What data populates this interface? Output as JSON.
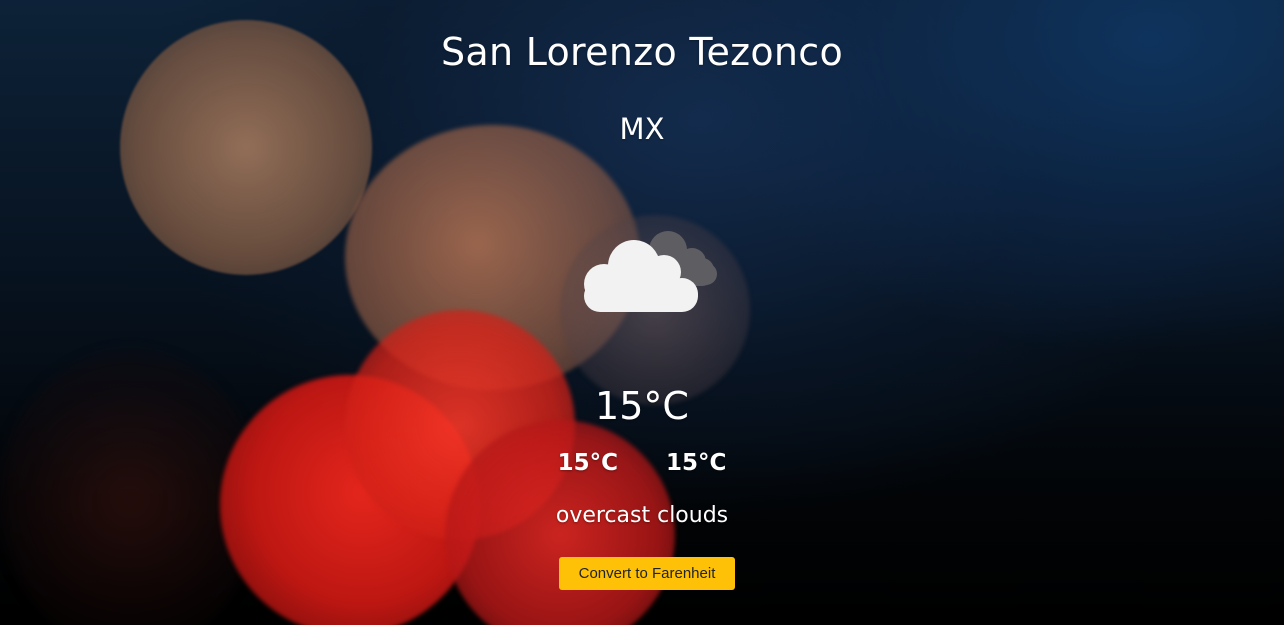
{
  "location": {
    "city": "San Lorenzo Tezonco",
    "country": "MX"
  },
  "weather": {
    "icon": "overcast-clouds-icon",
    "temperature": "15°C",
    "temp_min": "15°C",
    "temp_max": "15°C",
    "description": "overcast clouds"
  },
  "actions": {
    "convert_label": "Convert to Farenheit"
  },
  "colors": {
    "button_bg": "#ffc107",
    "button_text": "#212529",
    "text": "#ffffff"
  }
}
